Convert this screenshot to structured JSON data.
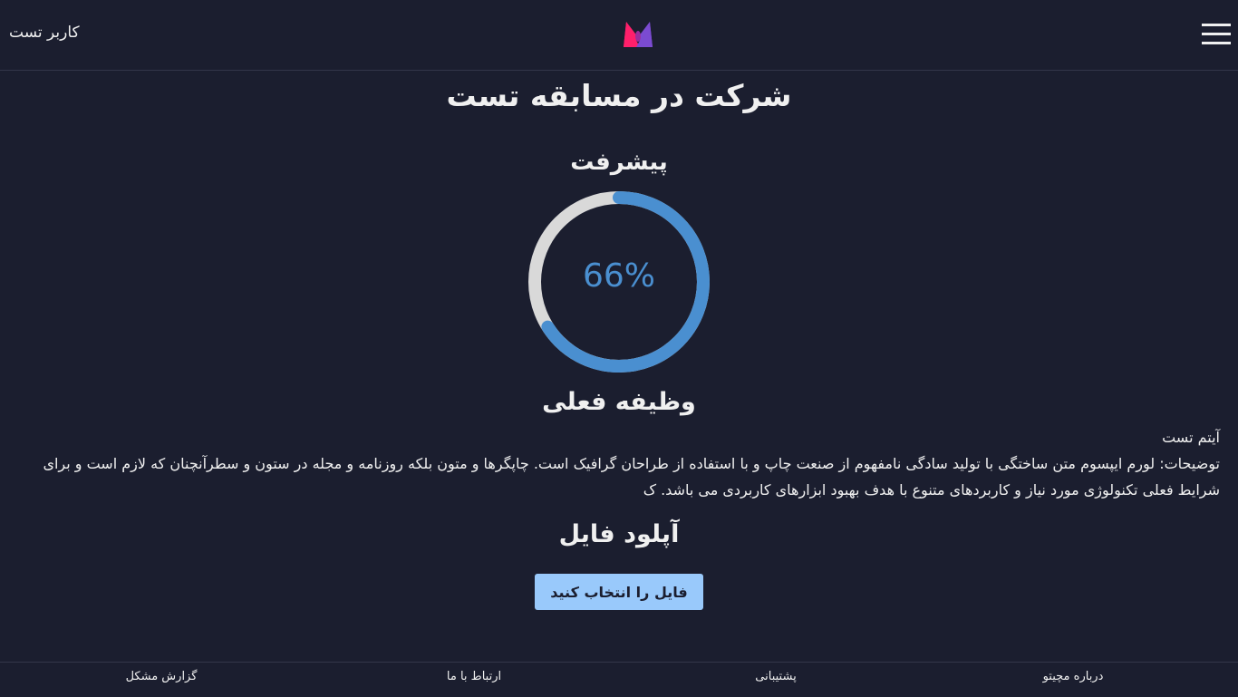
{
  "header": {
    "user_name": "کاربر تست",
    "logo_icon": "magento-m-logo",
    "menu_icon": "hamburger-icon"
  },
  "main": {
    "title": "شرکت در مسابقه تست",
    "progress": {
      "label": "پیشرفت",
      "percent": 66,
      "text": "66%",
      "fill_color": "#4a8fd0",
      "track_color": "#d9d9d9"
    },
    "current_task": {
      "heading": "وظیفه فعلی",
      "item_title": "آیتم تست",
      "description": "توضیحات: لورم ایپسوم متن ساختگی با تولید سادگی نامفهوم از صنعت چاپ و با استفاده از طراحان گرافیک است. چاپگرها و متون بلکه روزنامه و مجله در ستون و سطرآنچنان که لازم است و برای شرایط فعلی تکنولوژی مورد نیاز و کاربردهای متنوع با هدف بهبود ابزارهای کاربردی می باشد. ک"
    },
    "upload": {
      "heading": "آپلود فایل",
      "button_label": "فایل را انتخاب کنید"
    }
  },
  "footer": {
    "links": [
      "درباره مچیتو",
      "پشتیبانی",
      "ارتباط با ما",
      "گزارش مشکل"
    ]
  }
}
